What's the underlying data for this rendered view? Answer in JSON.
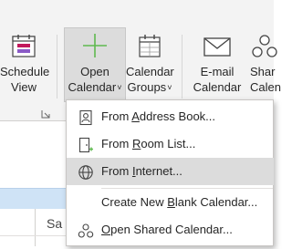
{
  "ribbon": {
    "schedule_view": {
      "line1": "Schedule",
      "line2": "View"
    },
    "open_calendar": {
      "line1": "Open",
      "line2": "Calendar"
    },
    "calendar_groups": {
      "line1": "Calendar",
      "line2": "Groups"
    },
    "email_calendar": {
      "line1": "E-mail",
      "line2": "Calendar"
    },
    "share_calendar": {
      "line1": "Shar",
      "line2": "Calen"
    },
    "chevron": "˅"
  },
  "calendar": {
    "day_label": "Sa"
  },
  "menu": {
    "items": [
      {
        "pre": "From ",
        "key": "A",
        "post": "ddress Book...",
        "icon": "address-book-icon"
      },
      {
        "pre": "From ",
        "key": "R",
        "post": "oom List...",
        "icon": "room-list-icon"
      },
      {
        "pre": "From ",
        "key": "I",
        "post": "nternet...",
        "icon": "globe-icon",
        "highlighted": true
      },
      {
        "pre": "Create New ",
        "key": "B",
        "post": "lank Calendar...",
        "icon": ""
      },
      {
        "pre": "",
        "key": "O",
        "post": "pen Shared Calendar...",
        "icon": "shared-calendar-icon"
      }
    ]
  },
  "colors": {
    "ribbon_bg": "#f3f3f3",
    "selected_button_bg": "#dcdcdc",
    "day_header_bg": "#cfe3f6",
    "accent_green": "#5fb94f",
    "accent_pink": "#c2185b",
    "accent_blue": "#3a78c3"
  }
}
